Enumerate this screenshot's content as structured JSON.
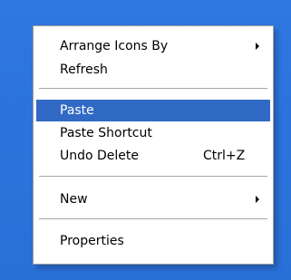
{
  "context_menu": {
    "items": [
      {
        "label": "Arrange Icons By",
        "submenu": true
      },
      {
        "label": "Refresh"
      },
      {
        "label": "Paste",
        "highlighted": true
      },
      {
        "label": "Paste Shortcut"
      },
      {
        "label": "Undo Delete",
        "shortcut": "Ctrl+Z"
      },
      {
        "label": "New",
        "submenu": true
      },
      {
        "label": "Properties"
      }
    ]
  },
  "colors": {
    "desktop_background": "#2c74dc",
    "highlight": "#316ac5",
    "menu_background": "#ffffff",
    "separator": "#a7a7a7"
  }
}
